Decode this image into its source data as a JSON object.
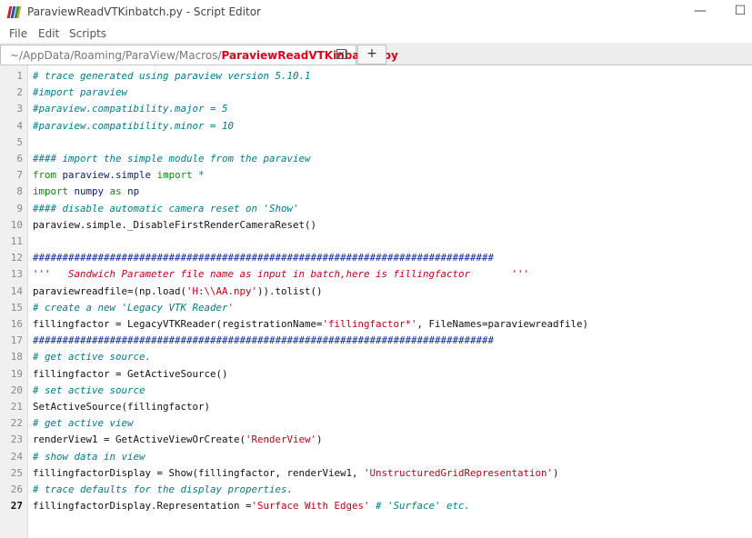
{
  "window": {
    "title": "ParaviewReadVTKinbatch.py - Script Editor",
    "minimize_glyph": "—",
    "maximize_glyph": "☐"
  },
  "menu": [
    "File",
    "Edit",
    "Scripts"
  ],
  "tabs": {
    "path_prefix": "~/AppData/Roaming/ParaView/Macros/",
    "file_name": "ParaviewReadVTKinbatch.py",
    "close_glyph": "×",
    "add_label": "+"
  },
  "editor": {
    "current_line": 27,
    "lines": [
      {
        "n": "1",
        "t": [
          {
            "c": "comment",
            "s": "# trace generated using paraview version 5.10.1"
          }
        ]
      },
      {
        "n": "2",
        "t": [
          {
            "c": "comment",
            "s": "#import paraview"
          }
        ]
      },
      {
        "n": "3",
        "t": [
          {
            "c": "comment",
            "s": "#paraview.compatibility.major = 5"
          }
        ]
      },
      {
        "n": "4",
        "t": [
          {
            "c": "comment",
            "s": "#paraview.compatibility.minor = 10"
          }
        ]
      },
      {
        "n": "5",
        "t": []
      },
      {
        "n": "6",
        "t": [
          {
            "c": "comment",
            "s": "#### import the simple module from the paraview"
          }
        ]
      },
      {
        "n": "7",
        "t": [
          {
            "c": "kw",
            "s": "from"
          },
          {
            "c": "",
            "s": " "
          },
          {
            "c": "mod",
            "s": "paraview.simple"
          },
          {
            "c": "",
            "s": " "
          },
          {
            "c": "kw",
            "s": "import"
          },
          {
            "c": "",
            "s": " "
          },
          {
            "c": "comment",
            "s": "*"
          }
        ]
      },
      {
        "n": "8",
        "t": [
          {
            "c": "kw",
            "s": "import"
          },
          {
            "c": "",
            "s": " "
          },
          {
            "c": "mod",
            "s": "numpy"
          },
          {
            "c": "",
            "s": " "
          },
          {
            "c": "kw",
            "s": "as"
          },
          {
            "c": "",
            "s": " "
          },
          {
            "c": "mod",
            "s": "np"
          }
        ]
      },
      {
        "n": "9",
        "t": [
          {
            "c": "comment",
            "s": "#### disable automatic camera reset on 'Show'"
          }
        ]
      },
      {
        "n": "10",
        "t": [
          {
            "c": "",
            "s": "paraview.simple._DisableFirstRenderCameraReset()"
          }
        ]
      },
      {
        "n": "11",
        "t": []
      },
      {
        "n": "12",
        "t": [
          {
            "c": "hash",
            "s": "##############################################################################"
          }
        ]
      },
      {
        "n": "13",
        "t": [
          {
            "c": "doc",
            "s": "'''   Sandwich Parameter file name as input in batch,here is fillingfactor       '''"
          }
        ]
      },
      {
        "n": "14",
        "t": [
          {
            "c": "",
            "s": "paraviewreadfile=(np.load("
          },
          {
            "c": "str",
            "s": "'H:\\\\AA.npy'"
          },
          {
            "c": "",
            "s": ")).tolist()"
          }
        ]
      },
      {
        "n": "15",
        "t": [
          {
            "c": "comment",
            "s": "# create a new 'Legacy VTK Reader'"
          }
        ]
      },
      {
        "n": "16",
        "t": [
          {
            "c": "",
            "s": "fillingfactor = LegacyVTKReader(registrationName="
          },
          {
            "c": "str",
            "s": "'fillingfactor*'"
          },
          {
            "c": "",
            "s": ", FileNames=paraviewreadfile)"
          }
        ]
      },
      {
        "n": "17",
        "t": [
          {
            "c": "hash",
            "s": "##############################################################################"
          }
        ]
      },
      {
        "n": "18",
        "t": [
          {
            "c": "comment",
            "s": "# get active source."
          }
        ]
      },
      {
        "n": "19",
        "t": [
          {
            "c": "",
            "s": "fillingfactor = GetActiveSource()"
          }
        ]
      },
      {
        "n": "20",
        "t": [
          {
            "c": "comment",
            "s": "# set active source"
          }
        ]
      },
      {
        "n": "21",
        "t": [
          {
            "c": "",
            "s": "SetActiveSource(fillingfactor)"
          }
        ]
      },
      {
        "n": "22",
        "t": [
          {
            "c": "comment",
            "s": "# get active view"
          }
        ]
      },
      {
        "n": "23",
        "t": [
          {
            "c": "",
            "s": "renderView1 = GetActiveViewOrCreate("
          },
          {
            "c": "str",
            "s": "'RenderView'"
          },
          {
            "c": "",
            "s": ")"
          }
        ]
      },
      {
        "n": "24",
        "t": [
          {
            "c": "comment",
            "s": "# show data in view"
          }
        ]
      },
      {
        "n": "25",
        "t": [
          {
            "c": "",
            "s": "fillingfactorDisplay = Show(fillingfactor, renderView1, "
          },
          {
            "c": "str",
            "s": "'UnstructuredGridRepresentation'"
          },
          {
            "c": "",
            "s": ")"
          }
        ]
      },
      {
        "n": "26",
        "t": [
          {
            "c": "comment",
            "s": "# trace defaults for the display properties."
          }
        ]
      },
      {
        "n": "27",
        "t": [
          {
            "c": "",
            "s": "fillingfactorDisplay.Representation ="
          },
          {
            "c": "str",
            "s": "'Surface With Edges'"
          },
          {
            "c": "",
            "s": " "
          },
          {
            "c": "comment",
            "s": "# 'Surface' etc."
          }
        ]
      }
    ]
  },
  "colors": {
    "comment": "#007a88",
    "keyword": "#0a8a0a",
    "string": "#c0001a",
    "tab_file": "#e0001a",
    "app_icon": [
      "#d0202a",
      "#2a4fb0",
      "#2a9a4a",
      "#e0a020"
    ]
  }
}
